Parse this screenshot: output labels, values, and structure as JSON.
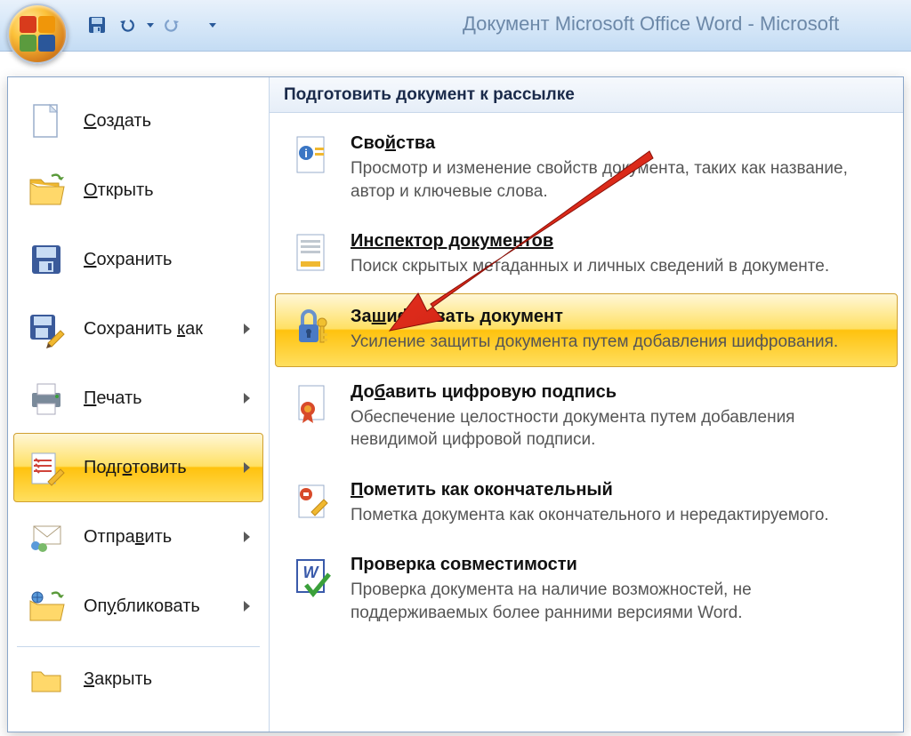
{
  "window": {
    "title": "Документ Microsoft Office Word - Microsoft "
  },
  "left_menu": {
    "items": [
      {
        "label": "Создать",
        "label_u_idx": 0,
        "has_arrow": false
      },
      {
        "label": "Открыть",
        "label_u_idx": 0,
        "has_arrow": false
      },
      {
        "label": "Сохранить",
        "label_u_idx": 0,
        "has_arrow": false
      },
      {
        "label": "Сохранить как",
        "label_u_idx": 10,
        "has_arrow": true
      },
      {
        "label": "Печать",
        "label_u_idx": 0,
        "has_arrow": true
      },
      {
        "label": "Подготовить",
        "label_u_idx": 4,
        "has_arrow": true,
        "selected": true
      },
      {
        "label": "Отправить",
        "label_u_idx": 5,
        "has_arrow": true
      },
      {
        "label": "Опубликовать",
        "label_u_idx": 2,
        "has_arrow": true
      },
      {
        "label": "Закрыть",
        "label_u_idx": 0,
        "has_arrow": false
      }
    ]
  },
  "right_panel": {
    "header": "Подготовить документ к рассылке",
    "items": [
      {
        "title": "Свойства",
        "title_u_idx": 3,
        "desc": "Просмотр и изменение свойств документа, таких как название, автор и ключевые слова."
      },
      {
        "title": "Инспектор документов",
        "title_u_idx": 0,
        "title_underline_all": true,
        "desc": "Поиск скрытых метаданных и личных сведений в документе."
      },
      {
        "title": "Зашифровать документ",
        "title_u_idx": 2,
        "selected": true,
        "desc": "Усиление защиты документа путем добавления шифрования."
      },
      {
        "title": "Добавить цифровую подпись",
        "title_u_idx": 2,
        "desc": "Обеспечение целостности документа путем добавления невидимой цифровой подписи."
      },
      {
        "title": "Пометить как окончательный",
        "title_u_idx": 0,
        "desc": "Пометка документа как окончательного и нередактируемого."
      },
      {
        "title": "Проверка совместимости",
        "desc": "Проверка документа на наличие возможностей, не поддерживаемых более ранними версиями Word."
      }
    ]
  }
}
